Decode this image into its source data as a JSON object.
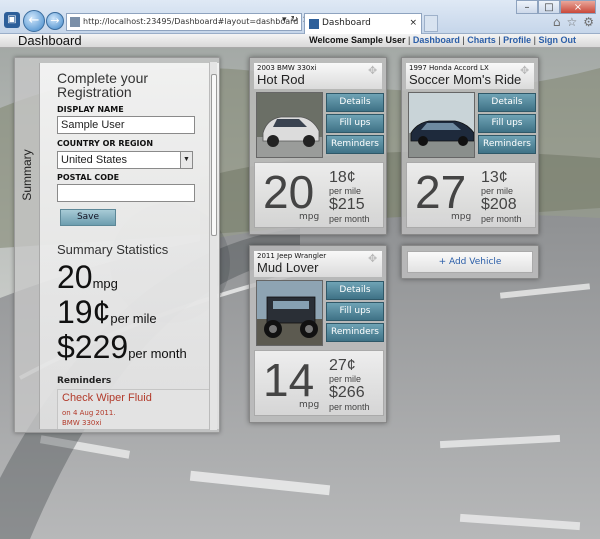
{
  "browser": {
    "address": "http://localhost:23495/Dashboard#layout=dashboard",
    "tab_title": "Dashboard",
    "icons": [
      "back-arrow-icon",
      "forward-arrow-icon",
      "refresh-icon",
      "home-icon",
      "star-icon",
      "gear-icon"
    ]
  },
  "header": {
    "title": "Dashboard",
    "welcome": "Welcome Sample User",
    "links": [
      "Dashboard",
      "Charts",
      "Profile",
      "Sign Out"
    ]
  },
  "sidebar": {
    "tab_label": "Summary",
    "registration": {
      "title": "Complete your Registration",
      "display_name_label": "DISPLAY NAME",
      "display_name_value": "Sample User",
      "country_label": "COUNTRY OR REGION",
      "country_value": "United States",
      "postal_label": "POSTAL CODE",
      "postal_value": "",
      "save_label": "Save"
    },
    "summary": {
      "title": "Summary Statistics",
      "mpg_value": "20",
      "mpg_unit": "mpg",
      "cost_mile_value": "19¢",
      "cost_mile_unit": "per mile",
      "cost_month_value": "$229",
      "cost_month_unit": "per month"
    },
    "reminders": {
      "title": "Reminders",
      "items": [
        {
          "title": "Check Wiper Fluid",
          "date": "on 4 Aug 2011.",
          "vehicle": "BMW 330xi"
        }
      ]
    }
  },
  "vehicles": [
    {
      "model": "2003 BMW 330xi",
      "name": "Hot Rod",
      "mpg": "20",
      "mpg_unit": "mpg",
      "per_mile": "18¢",
      "per_mile_unit": "per mile",
      "per_month": "$215",
      "per_month_unit": "per month",
      "color": "#d8d8d8"
    },
    {
      "model": "1997 Honda Accord LX",
      "name": "Soccer Mom's Ride",
      "mpg": "27",
      "mpg_unit": "mpg",
      "per_mile": "13¢",
      "per_mile_unit": "per mile",
      "per_month": "$208",
      "per_month_unit": "per month",
      "color": "#1e2a3c"
    },
    {
      "model": "2011 Jeep Wrangler",
      "name": "Mud Lover",
      "mpg": "14",
      "mpg_unit": "mpg",
      "per_mile": "27¢",
      "per_mile_unit": "per mile",
      "per_month": "$266",
      "per_month_unit": "per month",
      "color": "#2a2f36"
    }
  ],
  "vehicle_actions": {
    "details": "Details",
    "fillups": "Fill ups",
    "reminders": "Reminders"
  },
  "add_vehicle": {
    "label": "+ Add Vehicle"
  }
}
